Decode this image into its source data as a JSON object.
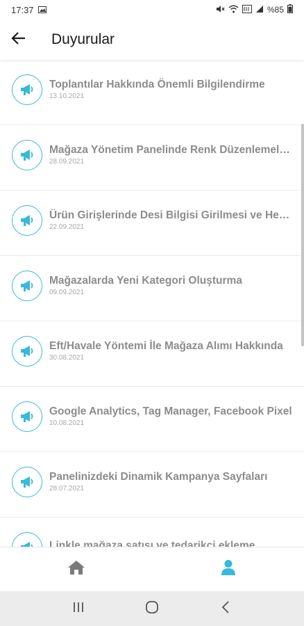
{
  "status_bar": {
    "time": "17:37",
    "battery": "%85"
  },
  "app_bar": {
    "title": "Duyurular"
  },
  "announcements": [
    {
      "title": "Toplantılar Hakkında Önemli Bilgilendirme",
      "date": "13.10.2021"
    },
    {
      "title": "Mağaza Yönetim Panelinde Renk Düzenlemeleri",
      "date": "28.09.2021"
    },
    {
      "title": "Ürün Girişlerinde Desi Bilgisi Girilmesi ve Hesaplanması",
      "date": "22.09.2021"
    },
    {
      "title": "Mağazalarda Yeni Kategori Oluşturma",
      "date": "09.09.2021"
    },
    {
      "title": "Eft/Havale Yöntemi İle Mağaza Alımı Hakkında",
      "date": "30.08.2021"
    },
    {
      "title": "Google Analytics, Tag Manager, Facebook Pixel",
      "date": "10.08.2021"
    },
    {
      "title": "Panelinizdeki Dinamik Kampanya Sayfaları",
      "date": "28.07.2021"
    },
    {
      "title": "Linkle mağaza satışı ve tedarikçi ekleme",
      "date": ""
    }
  ],
  "icons": {
    "announcement": "megaphone-icon",
    "back": "arrow-left-icon",
    "home": "home-icon",
    "profile": "user-icon"
  },
  "colors": {
    "accent": "#37b9d9",
    "inactive_nav": "#7a7a7a",
    "title_text": "#8c8c8c",
    "date_text": "#a8a8a8"
  }
}
